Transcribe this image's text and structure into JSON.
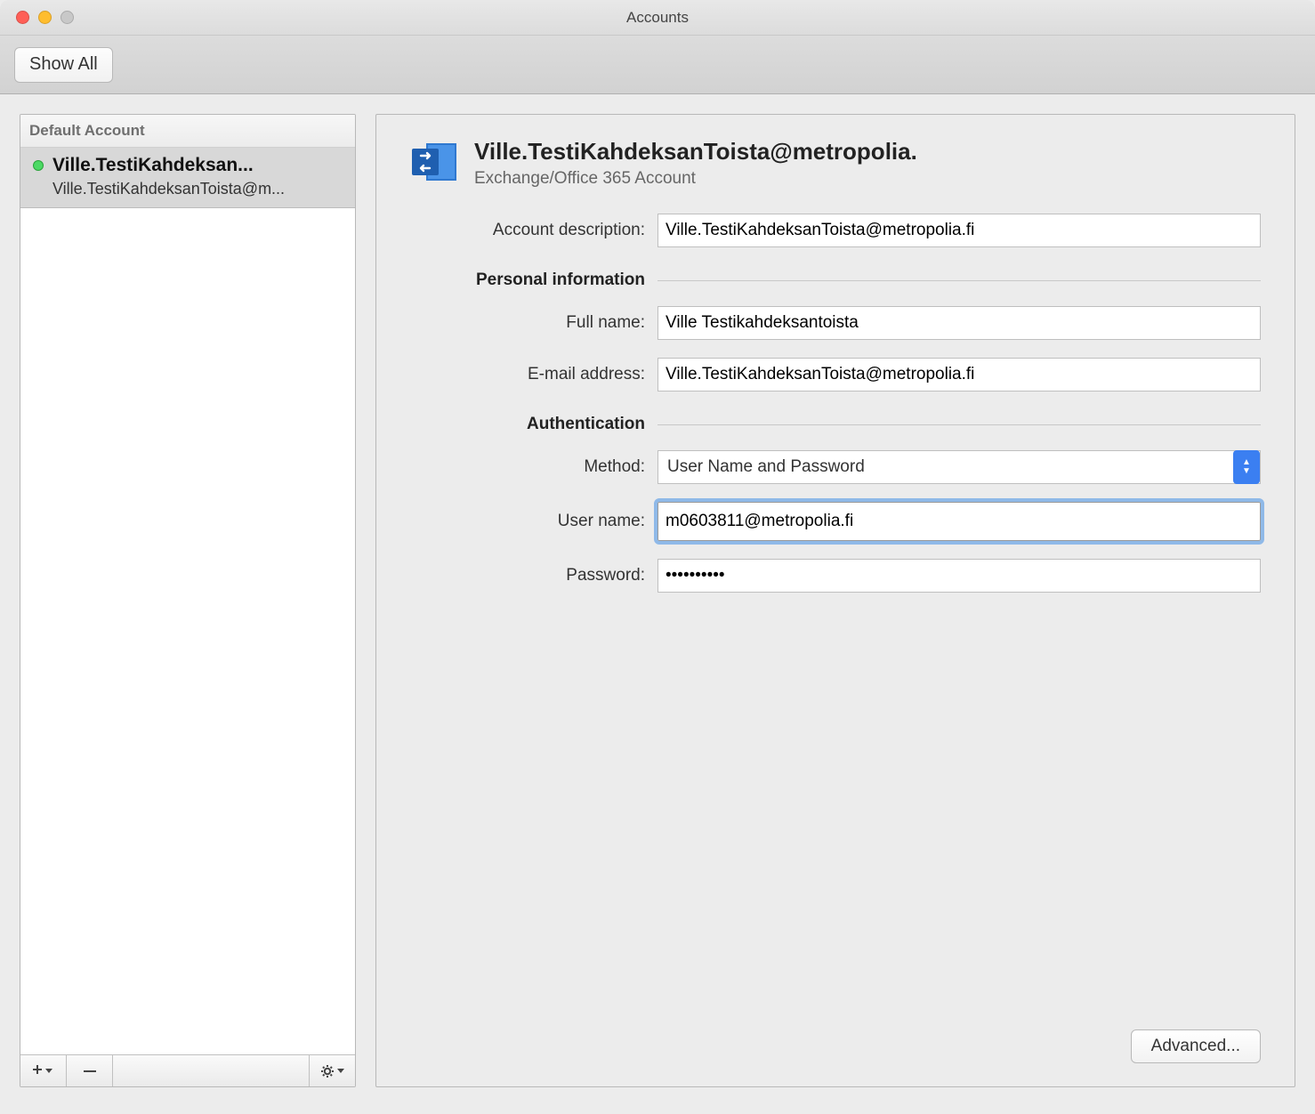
{
  "window": {
    "title": "Accounts",
    "show_all": "Show All"
  },
  "sidebar": {
    "header": "Default Account",
    "account": {
      "name": "Ville.TestiKahdeksan...",
      "sub": "Ville.TestiKahdeksanToista@m..."
    }
  },
  "main": {
    "title": "Ville.TestiKahdeksanToista@metropolia.",
    "subtitle": "Exchange/Office 365 Account",
    "labels": {
      "account_description": "Account description:",
      "personal_info": "Personal information",
      "full_name": "Full name:",
      "email": "E-mail address:",
      "authentication": "Authentication",
      "method": "Method:",
      "user_name": "User name:",
      "password": "Password:"
    },
    "fields": {
      "account_description": "Ville.TestiKahdeksanToista@metropolia.fi",
      "full_name": "Ville Testikahdeksantoista",
      "email": "Ville.TestiKahdeksanToista@metropolia.fi",
      "method": "User Name and Password",
      "user_name": "m0603811@metropolia.fi",
      "password": "••••••••••"
    },
    "advanced": "Advanced..."
  }
}
